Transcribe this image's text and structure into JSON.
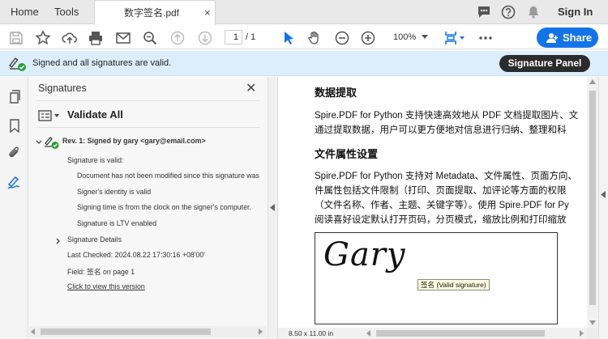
{
  "tabs": {
    "home": "Home",
    "tools": "Tools",
    "document": "数字签名.pdf",
    "close": "×"
  },
  "header": {
    "sign_in": "Sign In"
  },
  "toolbar": {
    "current_page": "1",
    "total_pages": "/ 1",
    "zoom": "100%",
    "share": "Share"
  },
  "banner": {
    "message": "Signed and all signatures are valid.",
    "button": "Signature Panel"
  },
  "signatures_pane": {
    "title": "Signatures",
    "validate_all": "Validate All",
    "revision": "Rev. 1: Signed by gary <gary@email.com>",
    "valid_heading": "Signature is valid:",
    "checks": [
      "Document has not been modified since this signature was",
      "Signer's identity is valid",
      "Signing time is from the clock on the signer's computer.",
      "Signature is LTV enabled"
    ],
    "details": "Signature Details",
    "last_checked": "Last Checked: 2024.08.22 17:30:16 +08'00'",
    "field": "Field: 签名 on page 1",
    "view_link": "Click to view this version"
  },
  "document": {
    "h1": "数据提取",
    "p1": [
      "Spire.PDF for Python 支持快速高效地从 PDF 文档提取图片、文",
      "通过提取数据，用户可以更方便地对信息进行归纳、整理和科"
    ],
    "h2": "文件属性设置",
    "p2": [
      "Spire.PDF for Python 支持对 Metadata、文件属性、页面方向、",
      "件属性包括文件限制（打印、页面提取、加评论等方面的权限",
      "（文件名称、作者、主题、关键字等）。使用 Spire.PDF for Py",
      "阅读喜好设定默认打开页码，分页模式，缩放比例和打印缩放"
    ],
    "signature_text": "Gary",
    "tooltip": "签名 (Valid signature)"
  },
  "status": {
    "page_size": "8.50 x 11.00 in"
  },
  "colors": {
    "accent": "#1473e6",
    "banner": "#dceefb",
    "valid": "#2d9d3a"
  }
}
